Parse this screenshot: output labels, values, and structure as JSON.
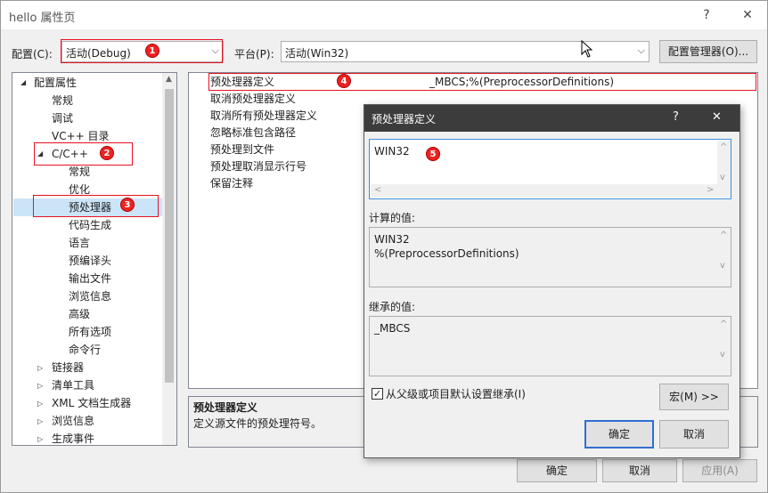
{
  "window": {
    "title": "hello 属性页",
    "help_glyph": "?",
    "close_glyph": "✕"
  },
  "toolbar": {
    "config_label": "配置(C):",
    "config_value": "活动(Debug)",
    "platform_label": "平台(P):",
    "platform_value": "活动(Win32)",
    "config_manager_label": "配置管理器(O)..."
  },
  "tree": {
    "items": [
      {
        "label": "配置属性",
        "expanded": true
      },
      {
        "label": "常规"
      },
      {
        "label": "调试"
      },
      {
        "label": "VC++ 目录"
      },
      {
        "label": "C/C++",
        "expanded": true
      },
      {
        "label": "常规"
      },
      {
        "label": "优化"
      },
      {
        "label": "预处理器",
        "selected": true
      },
      {
        "label": "代码生成"
      },
      {
        "label": "语言"
      },
      {
        "label": "预编译头"
      },
      {
        "label": "输出文件"
      },
      {
        "label": "浏览信息"
      },
      {
        "label": "高级"
      },
      {
        "label": "所有选项"
      },
      {
        "label": "命令行"
      },
      {
        "label": "链接器",
        "expanded": false
      },
      {
        "label": "清单工具",
        "expanded": false
      },
      {
        "label": "XML 文档生成器",
        "expanded": false
      },
      {
        "label": "浏览信息",
        "expanded": false
      },
      {
        "label": "生成事件",
        "expanded": false
      }
    ]
  },
  "grid": {
    "rows": [
      {
        "name": "预处理器定义",
        "value": "_MBCS;%(PreprocessorDefinitions)"
      },
      {
        "name": "取消预处理器定义",
        "value": ""
      },
      {
        "name": "取消所有预处理器定义",
        "value": ""
      },
      {
        "name": "忽略标准包含路径",
        "value": ""
      },
      {
        "name": "预处理到文件",
        "value": ""
      },
      {
        "name": "预处理取消显示行号",
        "value": ""
      },
      {
        "name": "保留注释",
        "value": ""
      }
    ]
  },
  "description": {
    "title": "预处理器定义",
    "text": "定义源文件的预处理符号。"
  },
  "footer": {
    "ok_label": "确定",
    "cancel_label": "取消",
    "apply_label": "应用(A)"
  },
  "dialog": {
    "title": "预处理器定义",
    "help_glyph": "?",
    "close_glyph": "✕",
    "edit_value": "WIN32",
    "computed_label": "计算的值:",
    "computed_lines": [
      "WIN32",
      "%(PreprocessorDefinitions)"
    ],
    "inherited_label": "继承的值:",
    "inherited_value": "_MBCS",
    "inherit_checkbox_label": "从父级或项目默认设置继承(I)",
    "inherit_checked": true,
    "macros_label": "宏(M) >>",
    "ok_label": "确定",
    "cancel_label": "取消"
  },
  "annotations": [
    "1",
    "2",
    "3",
    "4",
    "5"
  ],
  "colors": {
    "highlight_red": "#e81123",
    "badge_red": "#e22222",
    "selection_blue": "#cce4f7",
    "dialog_title_bg": "#3c3c3c",
    "default_button_border": "#2f6fcf"
  }
}
